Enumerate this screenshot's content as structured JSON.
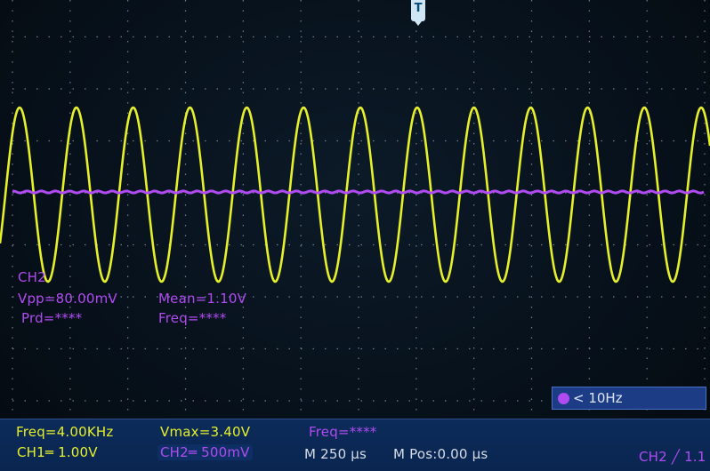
{
  "trigger": {
    "marker": "T"
  },
  "measurements": {
    "channel": "CH2",
    "vpp": "Vpp=80.00mV",
    "mean": "Mean=1.10V",
    "prd": "Prd=****",
    "freq": "Freq=****"
  },
  "status": {
    "freq_limit": "< 10Hz"
  },
  "bottom": {
    "freq_ch1": "Freq=4.00KHz",
    "vmax": "Vmax=3.40V",
    "freq_ch2": "Freq=****",
    "ch1_scale": "CH1═ 1.00V",
    "ch2_scale": "CH2═ 500mV",
    "timebase": "M 250 µs",
    "mpos": "M Pos:0.00 µs",
    "trigger_status": "CH2 ╱ 1.1"
  },
  "colors": {
    "ch1": "#e6f02a",
    "ch2": "#b04bf2",
    "background": "#07111c"
  },
  "waveforms": {
    "ch1": {
      "shape": "sine",
      "cycles_visible": 12.5
    },
    "ch2": {
      "shape": "flat"
    }
  }
}
